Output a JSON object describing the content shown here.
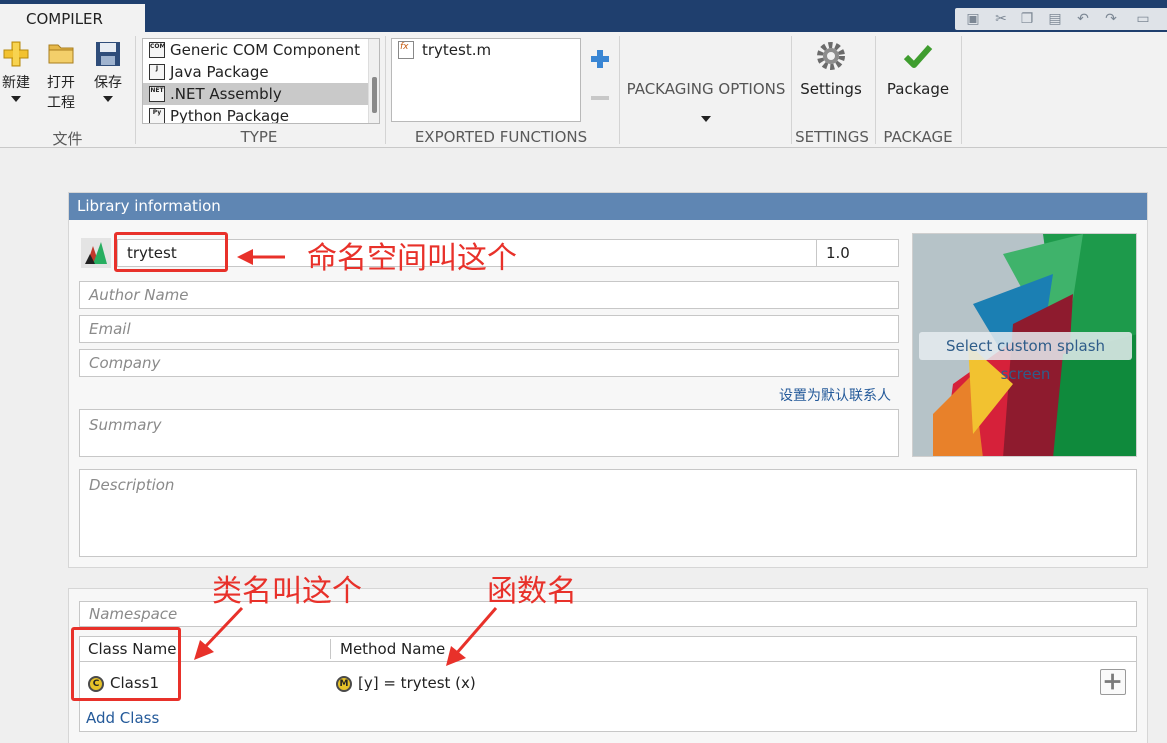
{
  "tab": {
    "label": "COMPILER"
  },
  "ribbon": {
    "file": {
      "new_label": "新建",
      "open_label_1": "打开",
      "open_label_2": "工程",
      "save_label": "保存",
      "group_label": "文件"
    },
    "type": {
      "items": [
        {
          "label": "Generic COM Component",
          "icon": "com-icon"
        },
        {
          "label": "Java Package",
          "icon": "java-icon"
        },
        {
          "label": ".NET Assembly",
          "icon": "net-icon"
        },
        {
          "label": "Python Package",
          "icon": "python-icon"
        }
      ],
      "selected": ".NET Assembly",
      "group_label": "TYPE"
    },
    "exported_functions": {
      "items": [
        "trytest.m"
      ],
      "group_label": "EXPORTED FUNCTIONS"
    },
    "packaging_options_label": "PACKAGING OPTIONS",
    "settings": {
      "label": "Settings",
      "group_label": "SETTINGS"
    },
    "package": {
      "label": "Package",
      "group_label": "PACKAGE"
    }
  },
  "library_info": {
    "header": "Library information",
    "name": "trytest",
    "version": "1.0",
    "author_placeholder": "Author Name",
    "email_placeholder": "Email",
    "company_placeholder": "Company",
    "default_contact_link": "设置为默认联系人",
    "summary_placeholder": "Summary",
    "description_placeholder": "Description",
    "splash_button": "Select custom splash screen"
  },
  "classes": {
    "namespace_placeholder": "Namespace",
    "col_class": "Class Name",
    "col_method": "Method Name",
    "rows": [
      {
        "class": "Class1",
        "method": "[y] = trytest (x)"
      }
    ],
    "add_class": "Add Class"
  },
  "annotations": {
    "namespace_note": "命名空间叫这个",
    "class_note": "类名叫这个",
    "function_note": "函数名"
  },
  "colors": {
    "accent": "#5f86b3",
    "annotation": "#e8312a",
    "title_bar": "#1f3f6e"
  }
}
